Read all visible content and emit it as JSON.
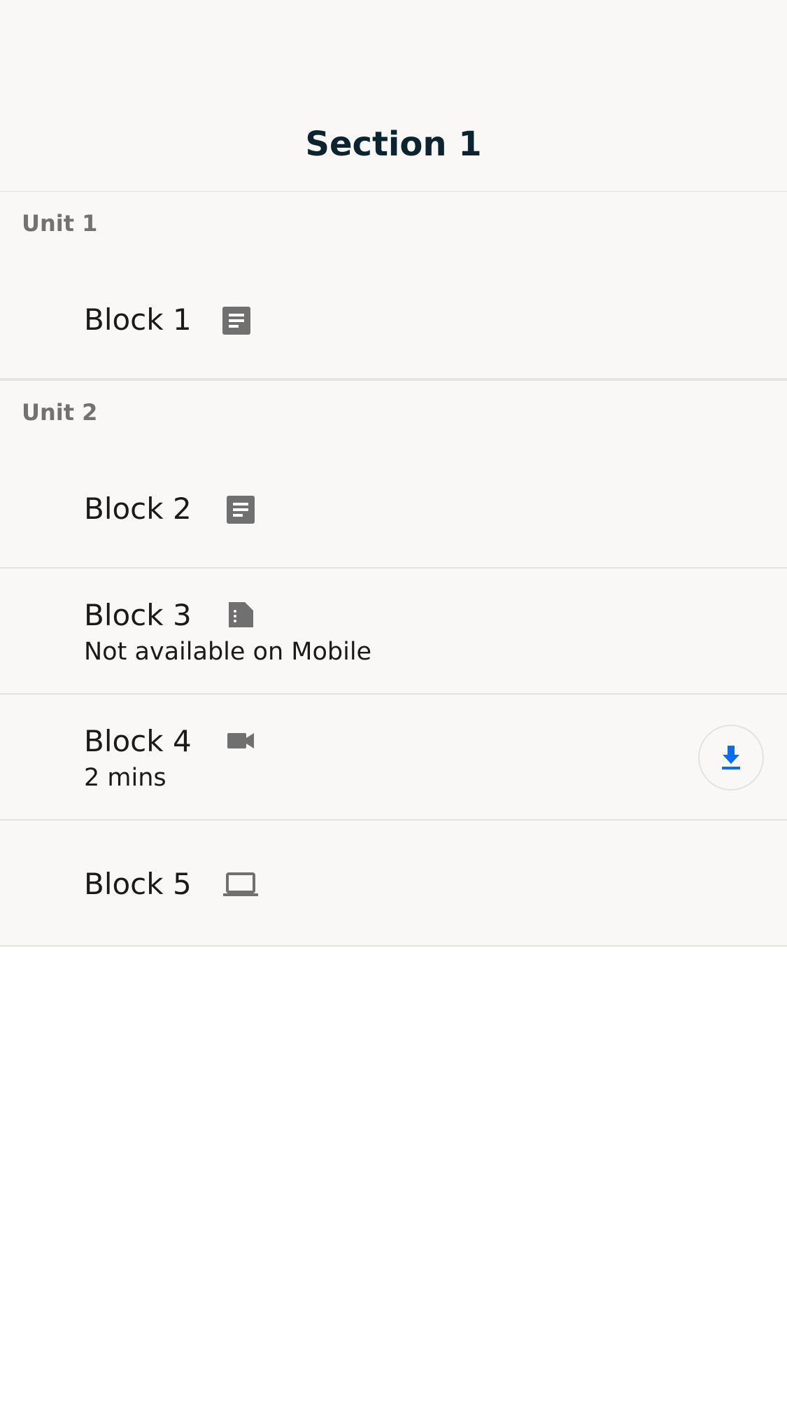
{
  "header": {
    "title": "Section 1"
  },
  "units": [
    {
      "label": "Unit 1",
      "blocks": [
        {
          "title": "Block 1",
          "icon": "document-icon"
        }
      ]
    },
    {
      "label": "Unit 2",
      "blocks": [
        {
          "title": "Block 2",
          "icon": "document-icon"
        },
        {
          "title": "Block 3",
          "icon": "unknown-file-icon",
          "subtitle": "Not available on Mobile"
        },
        {
          "title": "Block 4",
          "icon": "video-camera-icon",
          "subtitle": "2 mins",
          "action_icon": "download-icon"
        },
        {
          "title": "Block 5",
          "icon": "laptop-icon"
        }
      ]
    }
  ],
  "colors": {
    "background": "#f9f8f7",
    "title": "#0b2430",
    "unit_label": "#727272",
    "icon": "#707070",
    "accent": "#0a6cf0",
    "divider": "#e4e2e0"
  }
}
